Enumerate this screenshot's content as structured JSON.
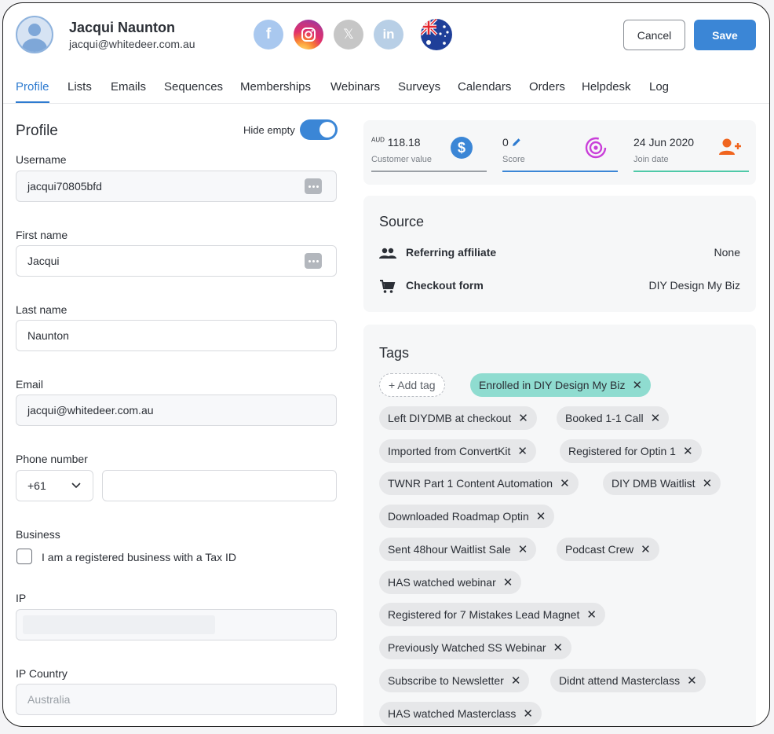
{
  "user": {
    "name": "Jacqui Naunton",
    "email": "jacqui@whitedeer.com.au"
  },
  "social": {
    "facebook": "f",
    "x": "𝕏",
    "linkedin": "in"
  },
  "actions": {
    "cancel": "Cancel",
    "save": "Save"
  },
  "tabs": [
    "Profile",
    "Lists",
    "Emails",
    "Sequences",
    "Memberships",
    "Webinars",
    "Surveys",
    "Calendars",
    "Orders",
    "Helpdesk",
    "Log"
  ],
  "profile": {
    "title": "Profile",
    "hide_empty": "Hide empty",
    "fields": {
      "username": {
        "label": "Username",
        "value": "jacqui70805bfd"
      },
      "first_name": {
        "label": "First name",
        "value": "Jacqui"
      },
      "last_name": {
        "label": "Last name",
        "value": "Naunton"
      },
      "email": {
        "label": "Email",
        "value": "jacqui@whitedeer.com.au"
      },
      "phone": {
        "label": "Phone number",
        "code": "+61"
      },
      "business": {
        "label": "Business",
        "checkbox": "I am a registered business with a Tax ID"
      },
      "ip": {
        "label": "IP"
      },
      "ip_country": {
        "label": "IP Country",
        "value": "Australia"
      }
    }
  },
  "stats": {
    "customer_value": {
      "currency": "AUD",
      "value": "118.18",
      "label": "Customer value"
    },
    "score": {
      "value": "0",
      "label": "Score"
    },
    "join_date": {
      "value": "24 Jun 2020",
      "label": "Join date"
    }
  },
  "source": {
    "title": "Source",
    "referring_affiliate": {
      "label": "Referring affiliate",
      "value": "None"
    },
    "checkout_form": {
      "label": "Checkout form",
      "value": "DIY Design My Biz"
    }
  },
  "tags": {
    "title": "Tags",
    "add": "+ Add tag",
    "items": [
      "Enrolled in DIY Design My Biz",
      "Left DIYDMB at checkout",
      "Booked 1-1 Call",
      "Imported from ConvertKit",
      "Registered for Optin 1",
      "TWNR Part 1 Content Automation",
      "DIY DMB Waitlist",
      "Downloaded Roadmap Optin",
      "Sent 48hour Waitlist Sale",
      "Podcast Crew",
      "HAS watched webinar",
      "Registered for 7 Mistakes Lead Magnet",
      "Previously Watched SS Webinar",
      "Subscribe to Newsletter",
      "Didnt attend Masterclass",
      "HAS watched Masterclass"
    ]
  },
  "colors": {
    "accent": "#3b86d6",
    "enrolled_tag": "#8fdcd0",
    "score_line": "#3b86d6",
    "join_line": "#4fc9a8"
  }
}
